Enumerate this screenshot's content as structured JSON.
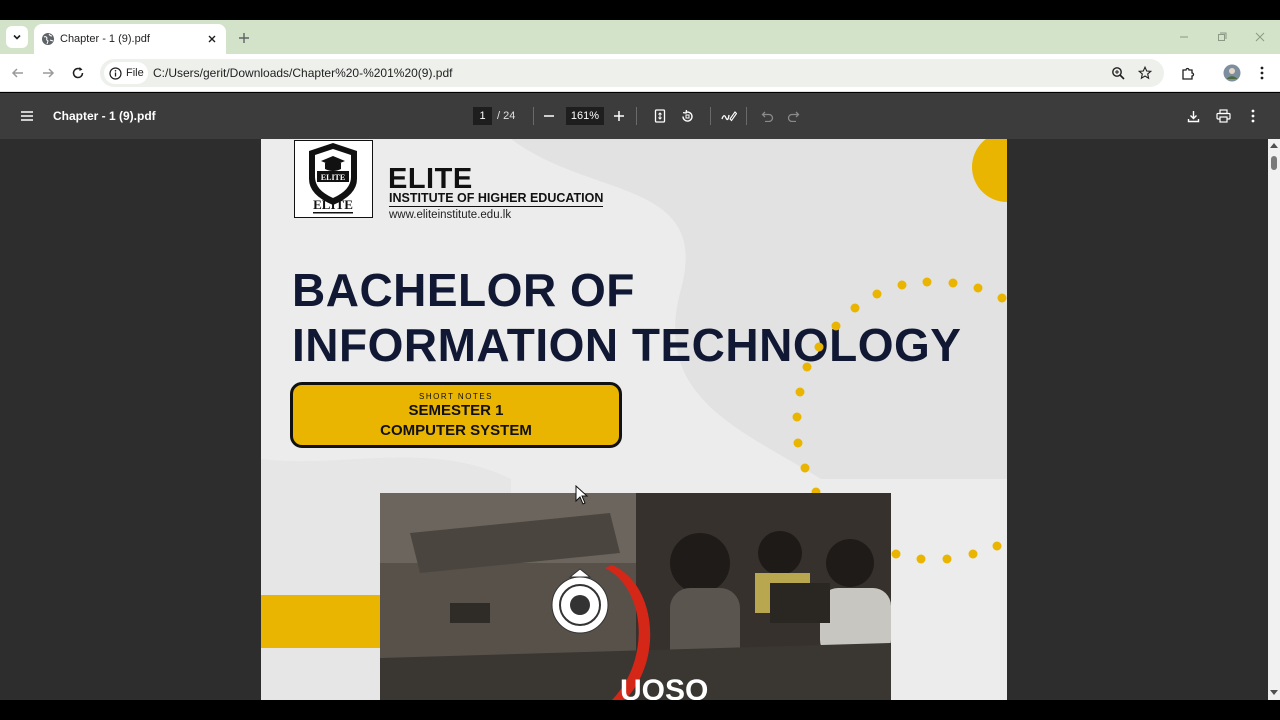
{
  "browser": {
    "tab_title": "Chapter - 1 (9).pdf",
    "chip_label": "File",
    "url": "C:/Users/gerit/Downloads/Chapter%20-%201%20(9).pdf"
  },
  "pdf_toolbar": {
    "title": "Chapter - 1 (9).pdf",
    "page_current": "1",
    "page_total": "/ 24",
    "zoom": "161%"
  },
  "document": {
    "brand": "ELITE",
    "brand_subtitle": "INSTITUTE OF HIGHER EDUCATION",
    "brand_url": "www.eliteinstitute.edu.lk",
    "logo_text": "ELITE",
    "heading_line1": "BACHELOR OF",
    "heading_line2": "INFORMATION TECHNOLOGY",
    "badge_small": "SHORT NOTES",
    "badge_line1": "SEMESTER 1",
    "badge_line2": "COMPUTER SYSTEM",
    "photo_caption_partial": "UOSO"
  },
  "colors": {
    "accent_yellow": "#e9b500",
    "heading_navy": "#111833",
    "tabstrip_green": "#d3e3c9",
    "pdf_toolbar": "#3c3c3c",
    "viewer_bg": "#2d2d2d"
  }
}
